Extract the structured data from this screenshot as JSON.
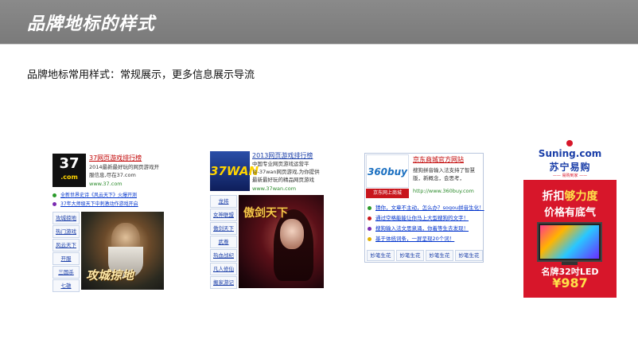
{
  "slide": {
    "title": "品牌地标的样式",
    "subtitle": "品牌地标常用样式：常规展示，更多信息展示导流"
  },
  "ad1": {
    "logo_text": "37",
    "logo_sub": ".com",
    "brand_link": "37网页游戏排行榜",
    "description": "2014最新最好玩的网页游戏开服信息,尽在37.com",
    "url": "www.37.com",
    "bullets": [
      {
        "text": "全新世界史诗《风云天下》火爆开测",
        "color": "#2a9a2a"
      },
      {
        "text": "37年大师级天下中刺激动作游戏开启",
        "color": "#7a2ab0"
      }
    ],
    "menu": [
      "攻城掠地",
      "热门游戏",
      "风云天下",
      "开服",
      "三国杀",
      "七雄"
    ],
    "art_caption": "攻城掠地"
  },
  "ad2": {
    "logo_text": "37WAN",
    "brand_link": "2013网页游戏排行榜",
    "description": "中国专业网页游戏运营平台-37wan网页游戏,为你提供最新最好玩的精品网页游戏",
    "url": "www.37wan.com",
    "menu": [
      "龙将",
      "女神联盟",
      "傲剑天下",
      "武尊",
      "热血战纪",
      "凡人修仙",
      "搬家游记"
    ],
    "art_caption": "傲剑天下"
  },
  "ad3": {
    "logo_text": "360buy",
    "logo_strip": "京东网上商城",
    "brand_link": "京东商城官方网站",
    "description": "搜狗拼音输入法支持了智慧版，新概念，会思考，",
    "url": "http://www.360buy.com",
    "bullets": [
      {
        "text": "猜你，文章不主动，怎么办？sogou拼音生化！",
        "color": "#2a9a2a"
      },
      {
        "text": "通过空格能能让你马上大型搜狗的文字！",
        "color": "#c8161d"
      },
      {
        "text": "搜狗输入法文思泉涌，你着等生去发现！",
        "color": "#7a2ab0"
      },
      {
        "text": "基于体统词条，一屏呈现20个词！",
        "color": "#e0b000"
      }
    ],
    "tags": [
      "妙笔生花",
      "妙笔生花",
      "妙笔生花",
      "妙笔生花"
    ]
  },
  "ad4": {
    "logo_en": "Suning.com",
    "logo_cn": "苏宁易购",
    "slogan": "—— 易购到家 ——",
    "promo_prefix": "折扣",
    "promo_highlight": "够力度",
    "promo_line2": "价格有底气",
    "model": "名牌32吋LED",
    "price": "¥987"
  }
}
